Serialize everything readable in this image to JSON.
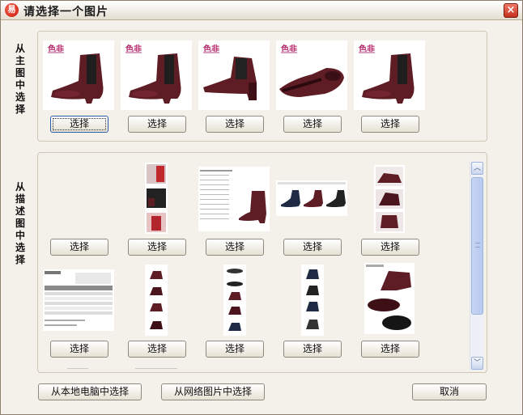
{
  "window": {
    "title": "请选择一个图片",
    "app_icon_glyph": "易",
    "close_glyph": "×"
  },
  "main_group": {
    "label": "从主图中选择",
    "thumbnails": [
      {
        "brand": "色非",
        "product": "burgundy ankle boot side view"
      },
      {
        "brand": "色非",
        "product": "burgundy ankle boot side view"
      },
      {
        "brand": "色非",
        "product": "burgundy ankle boot three-quarter view"
      },
      {
        "brand": "色非",
        "product": "burgundy ankle boot sole view"
      },
      {
        "brand": "色非",
        "product": "burgundy ankle boot side view"
      }
    ],
    "button_label": "选择"
  },
  "desc_group": {
    "label": "从描述图中选择",
    "row1": [
      {
        "kind": "model photos strip"
      },
      {
        "kind": "product spec sheet"
      },
      {
        "kind": "three boot colors"
      },
      {
        "kind": "boot detail strip"
      },
      {
        "kind": "boot detail strip"
      }
    ],
    "row2": [
      {
        "kind": "size chart table"
      },
      {
        "kind": "boot vertical strip"
      },
      {
        "kind": "boot vertical strip"
      },
      {
        "kind": "boot vertical strip"
      },
      {
        "kind": "boot close-up sole"
      }
    ],
    "button_label": "选择"
  },
  "scrollbar": {
    "up_glyph": "︿",
    "down_glyph": "﹀"
  },
  "footer": {
    "local_button": "从本地电脑中选择",
    "web_button": "从网络图片中选择",
    "cancel_button": "取消"
  },
  "colors": {
    "boot": "#5e1d25",
    "brand": "#b3266b",
    "window_bg": "#f4f1ea"
  }
}
